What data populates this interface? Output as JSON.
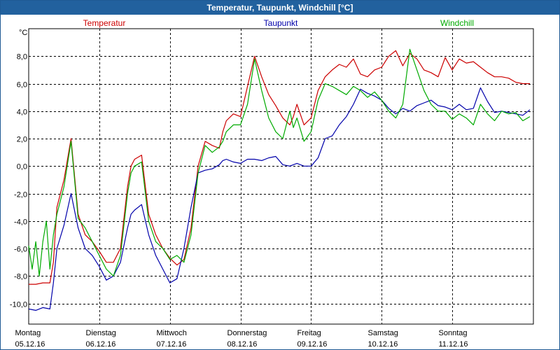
{
  "window": {
    "title": "Temperatur, Taupunkt, Windchill [°C]"
  },
  "chart_data": {
    "type": "line",
    "title": "Temperatur, Taupunkt, Windchill [°C]",
    "ylabel": "°C",
    "ylim": [
      -11.5,
      10.0
    ],
    "xlim": [
      0,
      7.15
    ],
    "grid": true,
    "legend_position": "top",
    "y_ticks": [
      "-10,0",
      "-8,0",
      "-6,0",
      "-4,0",
      "-2,0",
      "0,0",
      "2,0",
      "4,0",
      "6,0",
      "8,0"
    ],
    "y_tick_values": [
      -10,
      -8,
      -6,
      -4,
      -2,
      0,
      2,
      4,
      6,
      8
    ],
    "x_ticks": [
      {
        "day": "Montag",
        "date": "05.12.16"
      },
      {
        "day": "Dienstag",
        "date": "06.12.16"
      },
      {
        "day": "Mittwoch",
        "date": "07.12.16"
      },
      {
        "day": "Donnerstag",
        "date": "08.12.16"
      },
      {
        "day": "Freitag",
        "date": "09.12.16"
      },
      {
        "day": "Samstag",
        "date": "10.12.16"
      },
      {
        "day": "Sonntag",
        "date": "11.12.16"
      }
    ],
    "series": [
      {
        "name": "Temperatur",
        "color": "#cc0000",
        "x": [
          0.0,
          0.1,
          0.2,
          0.3,
          0.35,
          0.4,
          0.5,
          0.6,
          0.7,
          0.8,
          0.9,
          1.0,
          1.1,
          1.2,
          1.3,
          1.4,
          1.45,
          1.5,
          1.6,
          1.7,
          1.8,
          1.9,
          2.0,
          2.1,
          2.2,
          2.3,
          2.4,
          2.5,
          2.6,
          2.7,
          2.75,
          2.8,
          2.9,
          3.0,
          3.1,
          3.2,
          3.3,
          3.4,
          3.5,
          3.6,
          3.7,
          3.75,
          3.8,
          3.9,
          4.0,
          4.1,
          4.2,
          4.3,
          4.4,
          4.5,
          4.6,
          4.7,
          4.8,
          4.9,
          5.0,
          5.1,
          5.2,
          5.3,
          5.4,
          5.5,
          5.6,
          5.7,
          5.8,
          5.9,
          6.0,
          6.1,
          6.2,
          6.3,
          6.4,
          6.5,
          6.6,
          6.7,
          6.8,
          6.9,
          7.0,
          7.1
        ],
        "y": [
          -8.6,
          -8.6,
          -8.5,
          -8.5,
          -7.0,
          -3.0,
          -1.0,
          2.0,
          -3.5,
          -5.0,
          -5.5,
          -6.2,
          -7.0,
          -7.0,
          -6.0,
          -1.5,
          0.0,
          0.5,
          0.8,
          -3.5,
          -5.0,
          -6.0,
          -6.7,
          -7.2,
          -6.8,
          -4.5,
          0.0,
          1.8,
          1.5,
          1.3,
          2.5,
          3.3,
          3.8,
          3.6,
          5.8,
          8.0,
          6.5,
          5.2,
          4.4,
          3.5,
          3.0,
          3.6,
          4.5,
          3.0,
          3.5,
          5.5,
          6.5,
          7.0,
          7.4,
          7.2,
          7.8,
          6.7,
          6.5,
          7.0,
          7.2,
          8.0,
          8.4,
          7.3,
          8.2,
          7.8,
          7.0,
          6.8,
          6.5,
          7.9,
          7.0,
          7.8,
          7.5,
          7.6,
          7.2,
          6.8,
          6.5,
          6.5,
          6.4,
          6.1,
          6.0,
          6.0
        ]
      },
      {
        "name": "Taupunkt",
        "color": "#0000aa",
        "x": [
          0.0,
          0.1,
          0.2,
          0.3,
          0.35,
          0.4,
          0.5,
          0.6,
          0.7,
          0.8,
          0.9,
          1.0,
          1.1,
          1.2,
          1.3,
          1.4,
          1.45,
          1.5,
          1.6,
          1.7,
          1.8,
          1.9,
          2.0,
          2.1,
          2.2,
          2.3,
          2.4,
          2.5,
          2.6,
          2.7,
          2.75,
          2.8,
          2.9,
          3.0,
          3.1,
          3.2,
          3.3,
          3.4,
          3.5,
          3.6,
          3.7,
          3.75,
          3.8,
          3.9,
          4.0,
          4.1,
          4.2,
          4.3,
          4.4,
          4.5,
          4.6,
          4.7,
          4.8,
          4.9,
          5.0,
          5.1,
          5.2,
          5.3,
          5.4,
          5.5,
          5.6,
          5.7,
          5.8,
          5.9,
          6.0,
          6.1,
          6.2,
          6.3,
          6.4,
          6.5,
          6.6,
          6.7,
          6.8,
          6.9,
          7.0,
          7.1
        ],
        "y": [
          -10.4,
          -10.5,
          -10.3,
          -10.4,
          -8.5,
          -6.0,
          -4.3,
          -2.0,
          -4.5,
          -6.0,
          -6.5,
          -7.3,
          -8.3,
          -8.0,
          -7.0,
          -4.5,
          -3.5,
          -3.2,
          -2.8,
          -5.0,
          -6.5,
          -7.5,
          -8.5,
          -8.2,
          -6.0,
          -3.0,
          -0.5,
          -0.3,
          -0.2,
          0.1,
          0.4,
          0.5,
          0.3,
          0.2,
          0.5,
          0.5,
          0.4,
          0.6,
          0.7,
          0.1,
          0.0,
          0.1,
          0.2,
          0.0,
          0.0,
          0.6,
          2.0,
          2.2,
          3.0,
          3.6,
          4.5,
          5.6,
          5.3,
          5.1,
          4.8,
          4.2,
          3.8,
          4.2,
          4.0,
          4.4,
          4.6,
          4.8,
          4.4,
          4.3,
          4.1,
          4.5,
          4.1,
          4.2,
          5.7,
          4.7,
          3.9,
          4.0,
          3.9,
          3.8,
          3.7,
          4.1
        ]
      },
      {
        "name": "Windchill",
        "color": "#00aa00",
        "x": [
          0.0,
          0.05,
          0.1,
          0.15,
          0.2,
          0.25,
          0.3,
          0.35,
          0.4,
          0.5,
          0.6,
          0.7,
          0.8,
          0.9,
          1.0,
          1.1,
          1.2,
          1.3,
          1.4,
          1.45,
          1.5,
          1.6,
          1.7,
          1.8,
          1.9,
          2.0,
          2.1,
          2.2,
          2.3,
          2.4,
          2.5,
          2.6,
          2.7,
          2.75,
          2.8,
          2.9,
          3.0,
          3.1,
          3.2,
          3.3,
          3.4,
          3.5,
          3.6,
          3.7,
          3.75,
          3.8,
          3.9,
          4.0,
          4.1,
          4.2,
          4.3,
          4.4,
          4.5,
          4.6,
          4.7,
          4.8,
          4.9,
          5.0,
          5.1,
          5.2,
          5.3,
          5.4,
          5.5,
          5.6,
          5.7,
          5.8,
          5.9,
          6.0,
          6.1,
          6.2,
          6.3,
          6.4,
          6.5,
          6.6,
          6.7,
          6.8,
          6.9,
          7.0,
          7.1
        ],
        "y": [
          -5.8,
          -7.5,
          -5.5,
          -8.0,
          -5.5,
          -4.0,
          -7.5,
          -5.0,
          -3.5,
          -1.5,
          1.8,
          -3.8,
          -4.5,
          -5.5,
          -6.5,
          -7.5,
          -8.0,
          -6.5,
          -2.0,
          -0.5,
          0.0,
          0.3,
          -4.0,
          -5.5,
          -6.0,
          -6.8,
          -6.5,
          -7.0,
          -5.0,
          -0.5,
          1.5,
          1.0,
          1.4,
          1.8,
          2.5,
          3.0,
          3.0,
          4.5,
          7.8,
          5.5,
          3.5,
          2.5,
          2.0,
          4.0,
          2.8,
          3.5,
          1.8,
          2.5,
          4.8,
          6.0,
          5.8,
          5.5,
          5.2,
          5.8,
          5.5,
          5.0,
          5.4,
          4.8,
          4.0,
          3.5,
          4.5,
          8.5,
          7.0,
          5.5,
          4.5,
          4.0,
          4.0,
          3.4,
          3.8,
          3.5,
          3.0,
          4.5,
          3.8,
          3.3,
          4.0,
          3.8,
          3.9,
          3.3,
          3.6
        ]
      }
    ]
  }
}
